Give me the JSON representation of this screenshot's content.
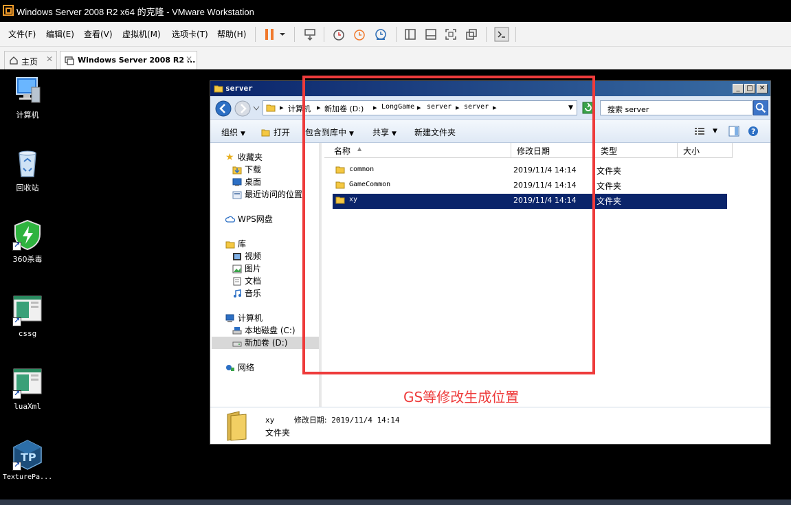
{
  "vm": {
    "title": "Windows Server 2008 R2 x64 的克隆 - VMware Workstation",
    "menu": [
      "文件(F)",
      "编辑(E)",
      "查看(V)",
      "虚拟机(M)",
      "选项卡(T)",
      "帮助(H)"
    ],
    "tabs": [
      {
        "label": "主页",
        "icon": "home-icon"
      },
      {
        "label": "Windows Server 2008 R2 ...",
        "icon": "vm-icon"
      }
    ]
  },
  "desktop": {
    "icons": [
      {
        "label": "计算机",
        "icon": "computer-icon"
      },
      {
        "label": "回收站",
        "icon": "recycle-bin-icon"
      },
      {
        "label": "360杀毒",
        "icon": "shield-icon"
      },
      {
        "label": "cssg",
        "icon": "app-window-icon"
      },
      {
        "label": "luaXml",
        "icon": "app-window-icon"
      },
      {
        "label": "TexturePa...",
        "icon": "texturepacker-icon"
      }
    ]
  },
  "explorer": {
    "title": "server",
    "address": {
      "crumbs": [
        "计算机",
        "新加卷 (D:)",
        "LongGame",
        "server",
        "server"
      ]
    },
    "search": {
      "text": "搜索 server"
    },
    "commands": [
      {
        "label": "组织",
        "dropdown": true
      },
      {
        "label": "打开",
        "dropdown": false
      },
      {
        "label": "包含到库中",
        "dropdown": true
      },
      {
        "label": "共享",
        "dropdown": true
      },
      {
        "label": "新建文件夹",
        "dropdown": false
      }
    ],
    "nav": {
      "favorites": "收藏夹",
      "favorites_items": [
        "下载",
        "桌面",
        "最近访问的位置"
      ],
      "wps": "WPS网盘",
      "libraries": "库",
      "libraries_items": [
        "视频",
        "图片",
        "文档",
        "音乐"
      ],
      "computer": "计算机",
      "computer_items": [
        "本地磁盘 (C:)",
        "新加卷 (D:)"
      ],
      "network": "网络"
    },
    "columns": [
      "名称",
      "修改日期",
      "类型",
      "大小"
    ],
    "rows": [
      {
        "name": "common",
        "date": "2019/11/4 14:14",
        "type": "文件夹",
        "selected": false
      },
      {
        "name": "GameCommon",
        "date": "2019/11/4 14:14",
        "type": "文件夹",
        "selected": false
      },
      {
        "name": "xy",
        "date": "2019/11/4 14:14",
        "type": "文件夹",
        "selected": true
      }
    ],
    "details": {
      "name": "xy",
      "date_label": "修改日期:",
      "date": "2019/11/4 14:14",
      "type": "文件夹"
    }
  },
  "annotation": {
    "text": "GS等修改生成位置",
    "color": "#ee3b3b"
  },
  "colors": {
    "selection": "#0a246a",
    "title_gradient_start": "#0a246a",
    "accent_red": "#ee3b3b"
  }
}
